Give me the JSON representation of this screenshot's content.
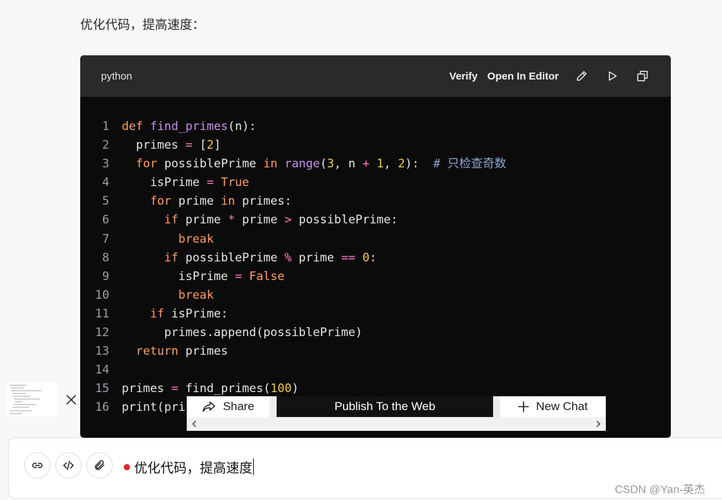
{
  "intro_text": "优化代码，提高速度：",
  "code_block": {
    "language": "python",
    "actions": {
      "verify": "Verify",
      "open_in_editor": "Open In Editor"
    },
    "lines": [
      {
        "n": "1",
        "tokens": [
          {
            "t": "kw",
            "v": "def "
          },
          {
            "t": "fn",
            "v": "find_primes"
          },
          {
            "t": "src",
            "v": "(n):"
          }
        ]
      },
      {
        "n": "2",
        "tokens": [
          {
            "t": "src",
            "v": "  primes "
          },
          {
            "t": "op",
            "v": "="
          },
          {
            "t": "src",
            "v": " ["
          },
          {
            "t": "num",
            "v": "2"
          },
          {
            "t": "src",
            "v": "]"
          }
        ]
      },
      {
        "n": "3",
        "tokens": [
          {
            "t": "src",
            "v": "  "
          },
          {
            "t": "kw",
            "v": "for"
          },
          {
            "t": "src",
            "v": " possiblePrime "
          },
          {
            "t": "kw",
            "v": "in"
          },
          {
            "t": "src",
            "v": " "
          },
          {
            "t": "fn",
            "v": "range"
          },
          {
            "t": "src",
            "v": "("
          },
          {
            "t": "num",
            "v": "3"
          },
          {
            "t": "src",
            "v": ", n "
          },
          {
            "t": "op",
            "v": "+"
          },
          {
            "t": "src",
            "v": " "
          },
          {
            "t": "num",
            "v": "1"
          },
          {
            "t": "src",
            "v": ", "
          },
          {
            "t": "num",
            "v": "2"
          },
          {
            "t": "src",
            "v": "):  "
          },
          {
            "t": "cmt",
            "v": "# 只检查奇数"
          }
        ]
      },
      {
        "n": "4",
        "tokens": [
          {
            "t": "src",
            "v": "    isPrime "
          },
          {
            "t": "op",
            "v": "="
          },
          {
            "t": "src",
            "v": " "
          },
          {
            "t": "kw",
            "v": "True"
          }
        ]
      },
      {
        "n": "5",
        "tokens": [
          {
            "t": "src",
            "v": "    "
          },
          {
            "t": "kw",
            "v": "for"
          },
          {
            "t": "src",
            "v": " prime "
          },
          {
            "t": "kw",
            "v": "in"
          },
          {
            "t": "src",
            "v": " primes:"
          }
        ]
      },
      {
        "n": "6",
        "tokens": [
          {
            "t": "src",
            "v": "      "
          },
          {
            "t": "kw",
            "v": "if"
          },
          {
            "t": "src",
            "v": " prime "
          },
          {
            "t": "op",
            "v": "*"
          },
          {
            "t": "src",
            "v": " prime "
          },
          {
            "t": "op",
            "v": ">"
          },
          {
            "t": "src",
            "v": " possiblePrime:"
          }
        ]
      },
      {
        "n": "7",
        "tokens": [
          {
            "t": "src",
            "v": "        "
          },
          {
            "t": "kw",
            "v": "break"
          }
        ]
      },
      {
        "n": "8",
        "tokens": [
          {
            "t": "src",
            "v": "      "
          },
          {
            "t": "kw",
            "v": "if"
          },
          {
            "t": "src",
            "v": " possiblePrime "
          },
          {
            "t": "op",
            "v": "%"
          },
          {
            "t": "src",
            "v": " prime "
          },
          {
            "t": "op",
            "v": "=="
          },
          {
            "t": "src",
            "v": " "
          },
          {
            "t": "num",
            "v": "0"
          },
          {
            "t": "src",
            "v": ":"
          }
        ]
      },
      {
        "n": "9",
        "tokens": [
          {
            "t": "src",
            "v": "        isPrime "
          },
          {
            "t": "op",
            "v": "="
          },
          {
            "t": "src",
            "v": " "
          },
          {
            "t": "kw",
            "v": "False"
          }
        ]
      },
      {
        "n": "10",
        "tokens": [
          {
            "t": "src",
            "v": "        "
          },
          {
            "t": "kw",
            "v": "break"
          }
        ]
      },
      {
        "n": "11",
        "tokens": [
          {
            "t": "src",
            "v": "    "
          },
          {
            "t": "kw",
            "v": "if"
          },
          {
            "t": "src",
            "v": " isPrime:"
          }
        ]
      },
      {
        "n": "12",
        "tokens": [
          {
            "t": "src",
            "v": "      primes.append(possiblePrime)"
          }
        ]
      },
      {
        "n": "13",
        "tokens": [
          {
            "t": "src",
            "v": "  "
          },
          {
            "t": "kw",
            "v": "return"
          },
          {
            "t": "src",
            "v": " primes"
          }
        ]
      },
      {
        "n": "14",
        "tokens": []
      },
      {
        "n": "15",
        "tokens": [
          {
            "t": "src",
            "v": "primes "
          },
          {
            "t": "op",
            "v": "="
          },
          {
            "t": "src",
            "v": " find_primes("
          },
          {
            "t": "num",
            "v": "100"
          },
          {
            "t": "src",
            "v": ")"
          }
        ]
      },
      {
        "n": "16",
        "tokens": [
          {
            "t": "src",
            "v": "print(pri"
          }
        ]
      }
    ]
  },
  "share_bar": {
    "share_label": "Share",
    "publish_label": "Publish To the Web",
    "new_chat_label": "New Chat"
  },
  "chat_input": {
    "value": "优化代码，提高速度"
  },
  "watermark": "CSDN @Yan-英杰",
  "colors": {
    "code_bg": "#0b0b0c",
    "header_bg": "#2a2a2c",
    "keyword": "#ff9e64",
    "function": "#c792ea",
    "number": "#f2c94c",
    "operator": "#ff79c6",
    "comment": "#8fa4c9",
    "recording_dot": "#e02424"
  }
}
